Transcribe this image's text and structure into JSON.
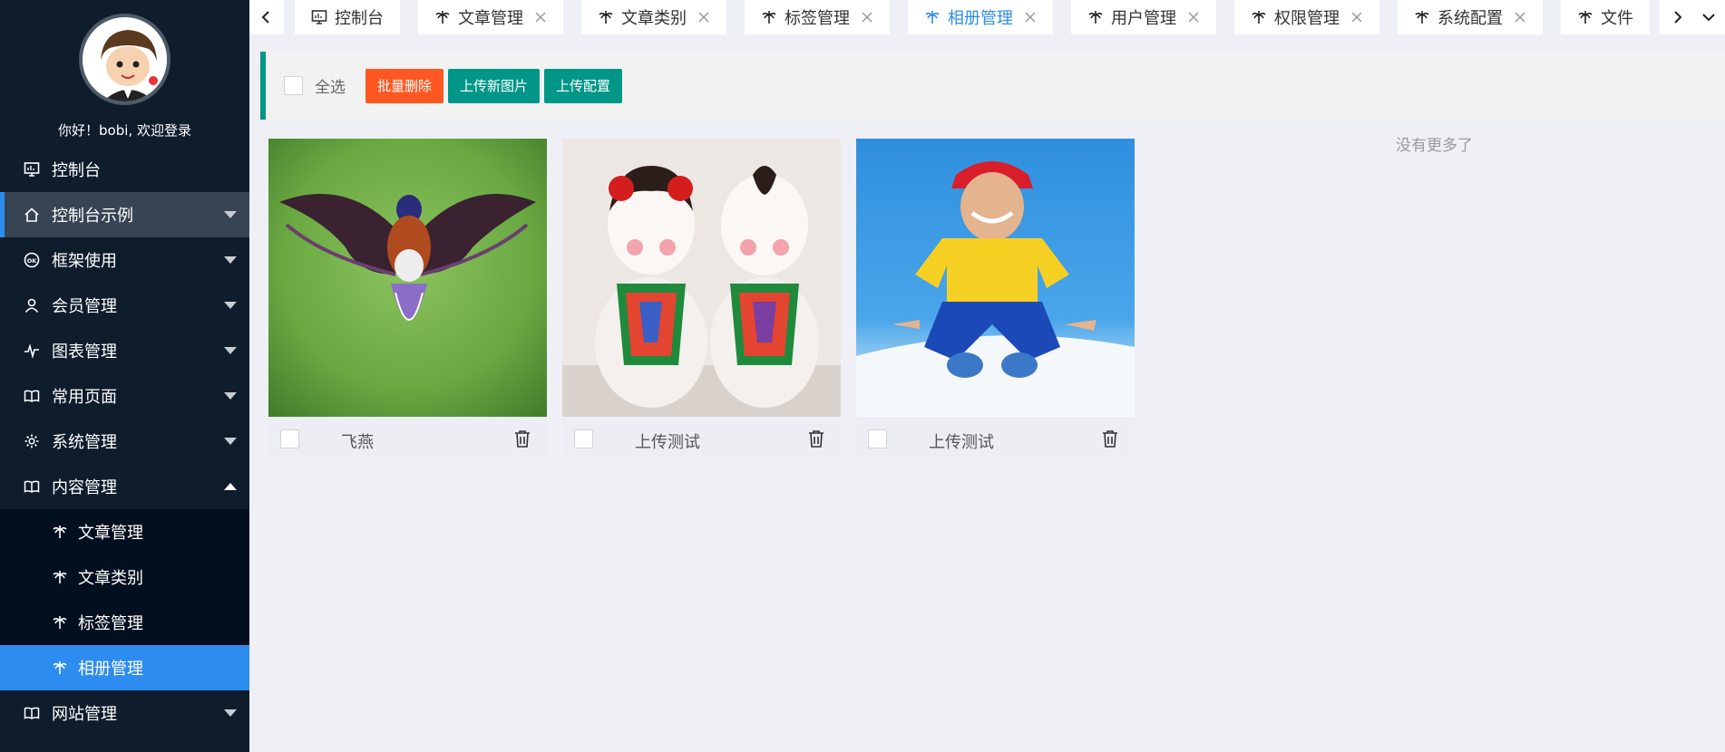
{
  "sidebar": {
    "welcome": "你好！bobi, 欢迎登录",
    "items": [
      {
        "label": "控制台"
      },
      {
        "label": "控制台示例"
      },
      {
        "label": "框架使用"
      },
      {
        "label": "会员管理"
      },
      {
        "label": "图表管理"
      },
      {
        "label": "常用页面"
      },
      {
        "label": "系统管理"
      },
      {
        "label": "内容管理"
      },
      {
        "label": "网站管理"
      }
    ],
    "sub_items": [
      {
        "label": "文章管理"
      },
      {
        "label": "文章类别"
      },
      {
        "label": "标签管理"
      },
      {
        "label": "相册管理"
      }
    ]
  },
  "tabs": [
    {
      "label": "控制台"
    },
    {
      "label": "文章管理"
    },
    {
      "label": "文章类别"
    },
    {
      "label": "标签管理"
    },
    {
      "label": "相册管理"
    },
    {
      "label": "用户管理"
    },
    {
      "label": "权限管理"
    },
    {
      "label": "系统配置"
    },
    {
      "label": "文件"
    }
  ],
  "toolbar": {
    "select_all": "全选",
    "batch_delete": "批量删除",
    "upload_new": "上传新图片",
    "upload_config": "上传配置"
  },
  "photos": [
    {
      "caption": "飞燕"
    },
    {
      "caption": "上传测试"
    },
    {
      "caption": "上传测试"
    }
  ],
  "no_more": "没有更多了",
  "colors": {
    "sidebar_bg": "#0f1c2c",
    "active_blue": "#2d8cf0",
    "teal": "#009688",
    "danger": "#ff5722"
  }
}
